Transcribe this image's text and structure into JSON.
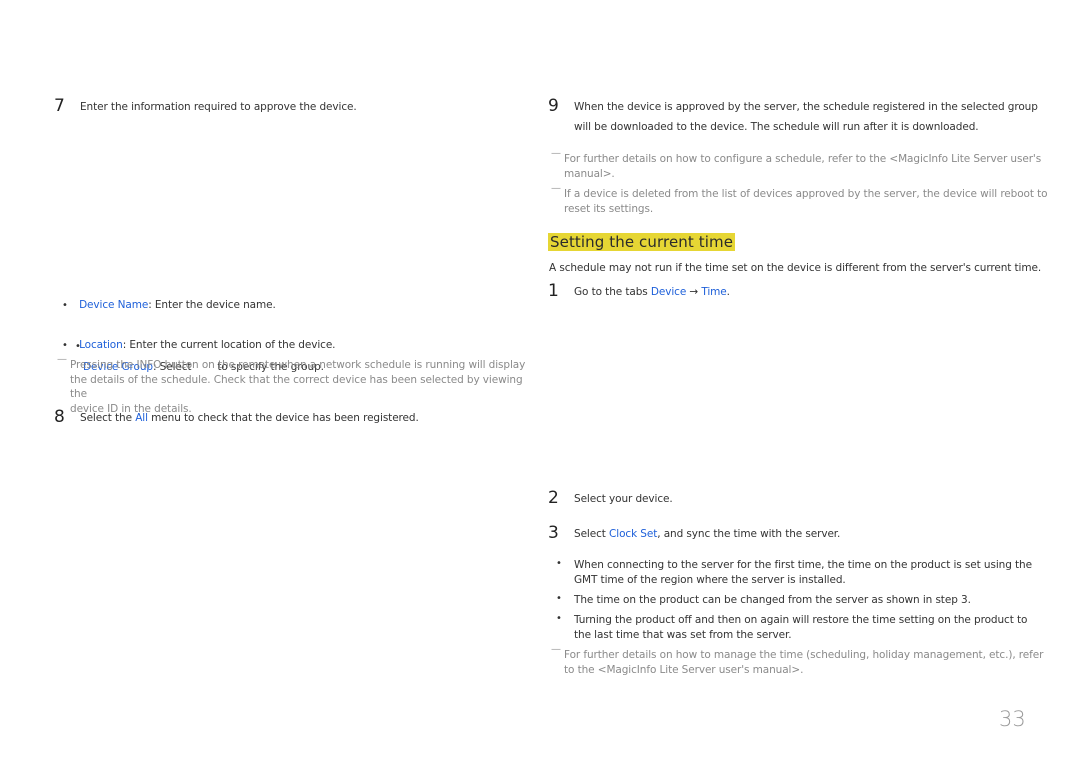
{
  "left_column": {
    "step7": {
      "number": "7",
      "text": "Enter the information required to approve the device."
    },
    "bullets": [
      {
        "label": "Device Name",
        "text": ": Enter the device name."
      },
      {
        "label": "Device Group",
        "text": ": Select        to specify the group."
      },
      {
        "label": "Location",
        "text": ": Enter the current location of the device."
      }
    ],
    "note": {
      "line1": "Pressing the INFO button on the remote when a network schedule is running will display",
      "line2": "the details of the schedule. Check that the correct device has been selected by viewing the",
      "line3": "device ID in the details."
    },
    "step8": {
      "number": "8",
      "before": "Select the ",
      "link": "All",
      "after": " menu to check that the device has been registered."
    }
  },
  "right_column": {
    "step9": {
      "number": "9",
      "line1": "When the device is approved by the server, the schedule registered in the selected group",
      "line2": "will be downloaded to the device. The schedule will run after it is downloaded."
    },
    "notes_top": [
      {
        "line1": "For further details on how to configure a schedule, refer to the <MagicInfo Lite Server user's",
        "line2": "manual>."
      },
      {
        "line1": "If a device is deleted from the list of devices approved by the server, the device will reboot to",
        "line2": "reset its settings."
      }
    ],
    "section_heading": "Setting the current time",
    "intro": "A schedule may not run if the time set on the device is different from the server's current time.",
    "step1": {
      "number": "1",
      "before": "Go to the tabs ",
      "link1": "Device",
      "arrow": " → ",
      "link2": "Time",
      "after": "."
    },
    "step2": {
      "number": "2",
      "text": "Select your device."
    },
    "step3": {
      "number": "3",
      "before": "Select ",
      "link": "Clock Set",
      "after": ", and sync the time with the server."
    },
    "bullets": [
      {
        "line1": "When connecting to the server for the first time, the time on the product is set using the",
        "line2": "GMT time of the region where the server is installed."
      },
      {
        "line1": "The time on the product can be changed from the server as shown in step 3.",
        "line2": ""
      },
      {
        "line1": "Turning the product off and then on again will restore the time setting on the product to",
        "line2": "the last time that was set from the server."
      }
    ],
    "note_bottom": {
      "line1": "For further details on how to manage the time (scheduling, holiday management, etc.), refer",
      "line2": "to the <MagicInfo Lite Server user's manual>."
    }
  },
  "footer": {
    "page_number": "33"
  },
  "colors": {
    "link": "#1d5fd9",
    "highlight": "#e6d634",
    "note": "#8a8a8a"
  }
}
